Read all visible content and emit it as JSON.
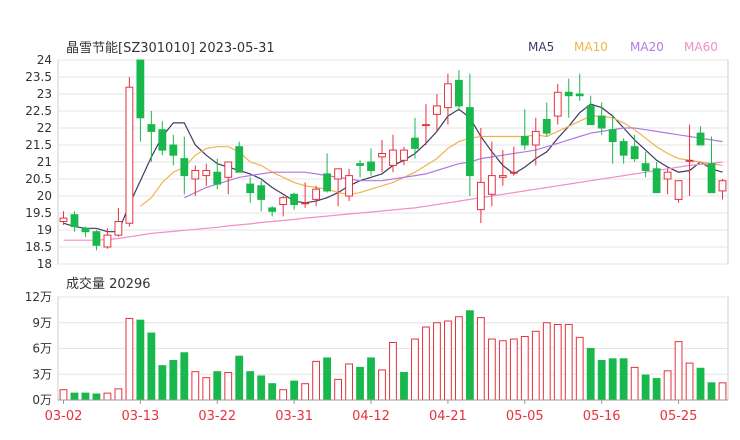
{
  "title": "晶雪节能[SZ301010] 2023-05-31",
  "legend": [
    {
      "label": "MA5",
      "color": "#3b3b66"
    },
    {
      "label": "MA10",
      "color": "#f0b34b"
    },
    {
      "label": "MA20",
      "color": "#b27ae0"
    },
    {
      "label": "MA60",
      "color": "#f08fc8"
    }
  ],
  "volume_title": "成交量 20296",
  "colors": {
    "up": "#e6323c",
    "down": "#19b84c",
    "grid": "#e5e5e5",
    "axis": "#555555",
    "date": "#e6323c",
    "text": "#333333"
  },
  "chart_data": [
    {
      "type": "candlestick",
      "name": "price",
      "ylim": [
        18,
        24
      ],
      "y_ticks": [
        "24",
        "23.5",
        "23",
        "22.5",
        "22",
        "21.5",
        "21",
        "20.5",
        "20",
        "19.5",
        "19",
        "18.5",
        "18"
      ],
      "dates": [
        "03-02",
        "03-03",
        "03-06",
        "03-07",
        "03-08",
        "03-09",
        "03-10",
        "03-13",
        "03-14",
        "03-15",
        "03-16",
        "03-17",
        "03-20",
        "03-21",
        "03-22",
        "03-23",
        "03-24",
        "03-27",
        "03-28",
        "03-29",
        "03-30",
        "03-31",
        "04-03",
        "04-04",
        "04-06",
        "04-07",
        "04-10",
        "04-11",
        "04-12",
        "04-13",
        "04-14",
        "04-17",
        "04-18",
        "04-19",
        "04-20",
        "04-21",
        "04-24",
        "04-25",
        "04-26",
        "04-27",
        "04-28",
        "05-04",
        "05-05",
        "05-08",
        "05-09",
        "05-10",
        "05-11",
        "05-12",
        "05-15",
        "05-16",
        "05-17",
        "05-18",
        "05-19",
        "05-22",
        "05-23",
        "05-24",
        "05-25",
        "05-26",
        "05-29",
        "05-30",
        "05-31"
      ],
      "x_ticks": [
        "03-02",
        "03-13",
        "03-22",
        "03-31",
        "04-12",
        "04-21",
        "05-05",
        "05-16",
        "05-25"
      ],
      "open": [
        19.25,
        19.45,
        19.05,
        18.95,
        18.5,
        18.85,
        19.2,
        24.0,
        22.1,
        21.95,
        21.5,
        21.1,
        20.5,
        20.6,
        20.7,
        20.55,
        21.45,
        20.35,
        20.3,
        19.65,
        19.75,
        20.05,
        19.8,
        19.9,
        20.65,
        20.5,
        20.0,
        20.95,
        21.0,
        21.15,
        20.9,
        21.05,
        21.7,
        22.1,
        22.4,
        22.6,
        23.4,
        22.6,
        19.6,
        20.05,
        20.55,
        20.7,
        21.75,
        21.5,
        22.25,
        22.35,
        23.05,
        23.0,
        22.65,
        22.35,
        21.95,
        21.6,
        21.45,
        20.95,
        20.8,
        20.5,
        19.9,
        21.05,
        21.85,
        20.95,
        20.15
      ],
      "high": [
        19.55,
        19.55,
        19.1,
        19.0,
        19.05,
        19.65,
        23.5,
        24.0,
        22.5,
        22.2,
        21.8,
        21.75,
        20.9,
        20.95,
        21.1,
        21.0,
        21.6,
        20.55,
        20.45,
        19.7,
        20.0,
        20.1,
        20.4,
        20.3,
        21.25,
        20.8,
        20.8,
        21.05,
        21.4,
        21.65,
        21.8,
        21.45,
        22.3,
        22.7,
        23.0,
        23.6,
        23.7,
        23.6,
        22.0,
        21.6,
        21.35,
        21.45,
        22.55,
        22.3,
        22.75,
        23.3,
        23.45,
        23.6,
        22.95,
        22.75,
        22.4,
        21.7,
        21.8,
        21.3,
        21.0,
        20.8,
        20.3,
        22.1,
        22.05,
        21.75,
        20.5
      ],
      "low": [
        19.15,
        18.95,
        18.8,
        18.4,
        18.45,
        18.8,
        19.1,
        21.6,
        21.0,
        21.2,
        20.9,
        20.05,
        20.0,
        20.3,
        20.2,
        20.05,
        20.7,
        19.8,
        19.55,
        19.4,
        19.4,
        19.6,
        19.65,
        19.7,
        20.1,
        19.7,
        19.85,
        20.55,
        20.6,
        20.7,
        20.7,
        20.9,
        21.1,
        21.5,
        21.9,
        22.1,
        22.5,
        20.0,
        19.2,
        19.7,
        20.3,
        20.6,
        21.35,
        20.9,
        21.75,
        22.1,
        22.3,
        22.8,
        22.2,
        21.8,
        20.95,
        20.95,
        21.0,
        20.55,
        20.2,
        20.05,
        19.8,
        20.0,
        21.6,
        20.1,
        19.9
      ],
      "close": [
        19.35,
        19.1,
        18.95,
        18.55,
        18.85,
        19.25,
        23.2,
        22.3,
        21.9,
        21.35,
        21.2,
        20.6,
        20.75,
        20.75,
        20.35,
        21.0,
        20.7,
        20.1,
        19.9,
        19.55,
        19.95,
        19.75,
        19.8,
        20.2,
        20.15,
        20.8,
        20.6,
        20.9,
        20.75,
        21.25,
        21.35,
        21.35,
        21.4,
        22.1,
        22.65,
        23.3,
        22.65,
        20.6,
        20.4,
        20.6,
        20.6,
        20.7,
        21.5,
        21.9,
        21.85,
        23.05,
        22.95,
        22.95,
        22.1,
        22.0,
        21.6,
        21.2,
        21.1,
        20.75,
        20.1,
        20.7,
        20.45,
        21.05,
        21.5,
        20.1,
        20.45
      ],
      "ma": {
        "MA5": [
          19.2,
          19.1,
          19.05,
          19.05,
          18.95,
          18.95,
          19.75,
          20.45,
          21.15,
          21.75,
          22.15,
          22.15,
          21.5,
          21.2,
          20.95,
          20.85,
          20.75,
          20.65,
          20.5,
          20.25,
          20.05,
          19.85,
          19.8,
          19.85,
          19.95,
          20.1,
          20.3,
          20.45,
          20.55,
          20.65,
          20.9,
          21.05,
          21.25,
          21.55,
          21.9,
          22.35,
          22.55,
          22.3,
          21.75,
          21.3,
          20.9,
          20.65,
          20.85,
          21.1,
          21.3,
          21.7,
          22.05,
          22.45,
          22.7,
          22.6,
          22.35,
          22.0,
          21.65,
          21.35,
          21.05,
          20.85,
          20.7,
          20.75,
          21.0,
          20.8,
          20.7
        ],
        "MA10": [
          null,
          null,
          null,
          null,
          null,
          null,
          null,
          19.7,
          19.95,
          20.4,
          20.7,
          20.85,
          21.2,
          21.4,
          21.45,
          21.45,
          21.3,
          21.0,
          20.9,
          20.7,
          20.55,
          20.4,
          20.3,
          20.25,
          20.2,
          20.1,
          20.05,
          20.1,
          20.2,
          20.3,
          20.4,
          20.55,
          20.7,
          20.9,
          21.1,
          21.4,
          21.6,
          21.7,
          21.75,
          21.75,
          21.75,
          21.75,
          21.75,
          21.8,
          21.75,
          21.9,
          22.05,
          22.2,
          22.35,
          22.35,
          22.3,
          22.15,
          21.95,
          21.7,
          21.45,
          21.25,
          21.1,
          21.05,
          21.0,
          20.95,
          20.9
        ],
        "MA20": [
          null,
          null,
          null,
          null,
          null,
          null,
          null,
          null,
          null,
          null,
          null,
          19.95,
          20.1,
          20.25,
          20.35,
          20.45,
          20.55,
          20.6,
          20.65,
          20.7,
          20.7,
          20.7,
          20.7,
          20.65,
          20.6,
          20.55,
          20.5,
          20.45,
          20.45,
          20.45,
          20.5,
          20.55,
          20.6,
          20.65,
          20.75,
          20.85,
          20.95,
          21.0,
          21.1,
          21.15,
          21.2,
          21.25,
          21.3,
          21.35,
          21.45,
          21.55,
          21.65,
          21.75,
          21.85,
          21.9,
          21.95,
          22.0,
          22.0,
          21.95,
          21.9,
          21.85,
          21.8,
          21.75,
          21.7,
          21.65,
          21.6
        ],
        "MA60": [
          18.7,
          18.7,
          18.7,
          18.7,
          18.72,
          18.75,
          18.8,
          18.85,
          18.9,
          18.93,
          18.96,
          18.99,
          19.02,
          19.05,
          19.08,
          19.12,
          19.15,
          19.18,
          19.22,
          19.25,
          19.28,
          19.31,
          19.35,
          19.38,
          19.41,
          19.44,
          19.47,
          19.5,
          19.53,
          19.56,
          19.59,
          19.62,
          19.65,
          19.7,
          19.75,
          19.8,
          19.85,
          19.9,
          19.95,
          20.0,
          20.05,
          20.1,
          20.15,
          20.2,
          20.25,
          20.3,
          20.35,
          20.4,
          20.45,
          20.5,
          20.55,
          20.6,
          20.65,
          20.7,
          20.75,
          20.8,
          20.85,
          20.9,
          20.93,
          20.96,
          21.0
        ]
      }
    },
    {
      "type": "bar",
      "name": "volume",
      "ylim": [
        0,
        12
      ],
      "y_unit": "万",
      "y_ticks": [
        "12万",
        "9万",
        "6万",
        "3万",
        "0万"
      ],
      "values": [
        1.2,
        0.8,
        0.8,
        0.7,
        0.8,
        1.3,
        9.5,
        9.3,
        7.8,
        4.0,
        4.6,
        5.5,
        3.3,
        2.6,
        3.3,
        3.2,
        5.1,
        3.3,
        2.8,
        1.9,
        1.2,
        2.2,
        1.9,
        4.5,
        4.9,
        2.4,
        4.2,
        3.8,
        4.9,
        3.5,
        6.7,
        3.2,
        7.1,
        8.5,
        9.0,
        9.2,
        9.7,
        10.4,
        9.6,
        7.1,
        6.9,
        7.1,
        7.4,
        8.0,
        9.0,
        8.8,
        8.8,
        7.3,
        6.0,
        4.6,
        4.8,
        4.8,
        3.8,
        2.9,
        2.5,
        3.4,
        6.8,
        4.3,
        3.7,
        2.0,
        2.0
      ],
      "up": [
        true,
        false,
        false,
        false,
        true,
        true,
        true,
        false,
        false,
        false,
        false,
        false,
        true,
        true,
        false,
        true,
        false,
        false,
        false,
        false,
        true,
        false,
        true,
        true,
        false,
        true,
        true,
        false,
        false,
        true,
        true,
        false,
        true,
        true,
        true,
        true,
        true,
        false,
        true,
        true,
        true,
        true,
        true,
        true,
        true,
        true,
        true,
        true,
        false,
        false,
        false,
        false,
        true,
        false,
        false,
        true,
        true,
        true,
        false,
        false,
        true
      ]
    }
  ]
}
